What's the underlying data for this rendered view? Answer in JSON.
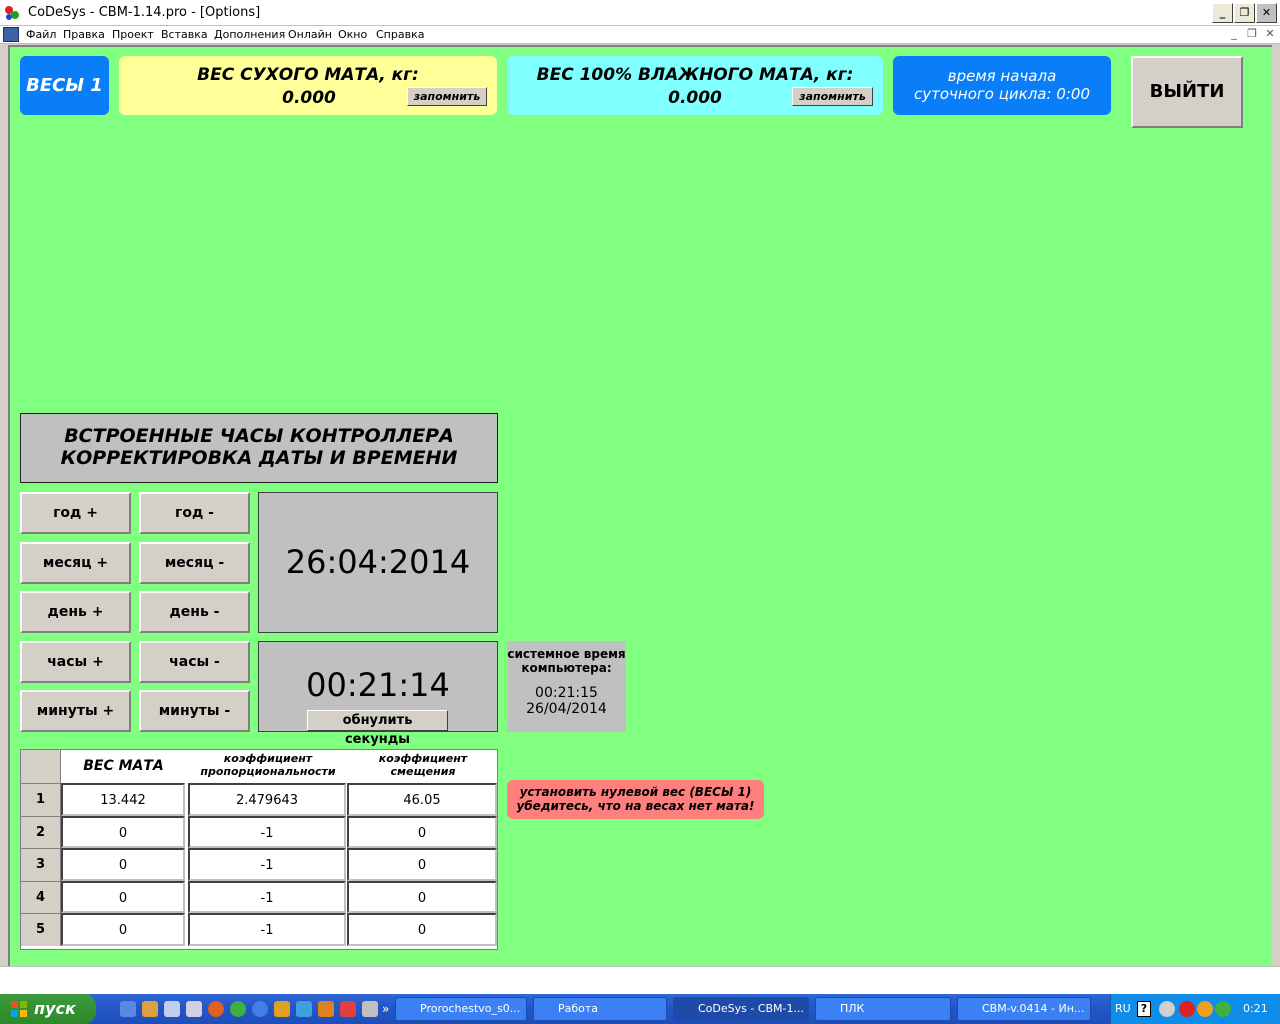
{
  "window": {
    "title": "CoDeSys - CBM-1.14.pro - [Options]",
    "min_label": "_",
    "max_label": "❐",
    "close_label": "✕"
  },
  "menu": {
    "items": [
      "Файл",
      "Правка",
      "Проект",
      "Вставка",
      "Дополнения",
      "Онлайн",
      "Окно",
      "Справка"
    ],
    "mdi": [
      "_",
      "❐",
      "✕"
    ]
  },
  "header": {
    "scale_label": "ВЕСЫ 1",
    "dry_label": "ВЕС СУХОГО МАТА, кг:",
    "dry_value": "0.000",
    "dry_btn": "запомнить",
    "wet_label": "ВЕС 100% ВЛАЖНОГО  МАТА, кг:",
    "wet_value": "0.000",
    "wet_btn": "запомнить",
    "cycle_line1": "время начала",
    "cycle_line2": "суточного цикла: 0:00",
    "exit_label": "ВЫЙТИ"
  },
  "clock": {
    "title1": "ВСТРОЕННЫЕ ЧАСЫ КОНТРОЛЛЕРА",
    "title2": "КОРРЕКТИРОВКА ДАТЫ И ВРЕМЕНИ",
    "buttons": [
      {
        "plus": "год +",
        "minus": "год -"
      },
      {
        "plus": "месяц +",
        "minus": "месяц -"
      },
      {
        "plus": "день +",
        "minus": "день -"
      },
      {
        "plus": "часы +",
        "minus": "часы -"
      },
      {
        "plus": "минуты +",
        "minus": "минуты -"
      }
    ],
    "date": "26:04:2014",
    "time": "00:21:14",
    "reset_btn": "обнулить секунды",
    "sys_label1": "системное время",
    "sys_label2": "компьютера:",
    "sys_time": "00:21:15",
    "sys_date": "26/04/2014"
  },
  "table": {
    "headers": [
      "ВЕС МАТА",
      "коэффициент пропорциональности",
      "коэффициент смещения"
    ],
    "header_lines": {
      "col1": "ВЕС МАТА",
      "col2a": "коэффициент",
      "col2b": "пропорциональности",
      "col3a": "коэффициент",
      "col3b": "смещения"
    },
    "rows": [
      {
        "n": "1",
        "w": "13.442",
        "k": "2.479643",
        "s": "46.05"
      },
      {
        "n": "2",
        "w": "0",
        "k": "-1",
        "s": "0"
      },
      {
        "n": "3",
        "w": "0",
        "k": "-1",
        "s": "0"
      },
      {
        "n": "4",
        "w": "0",
        "k": "-1",
        "s": "0"
      },
      {
        "n": "5",
        "w": "0",
        "k": "-1",
        "s": "0"
      }
    ]
  },
  "zero_btn": {
    "line1": "установить нулевой вес (ВЕСЫ 1)",
    "line2": "убедитесь, что на весах нет мата!"
  },
  "taskbar": {
    "start": "пуск",
    "tasks": [
      "Prorochestvo_s0...",
      "Работа",
      "CoDeSys - CBM-1...",
      "ПЛК",
      "CBM-v.0414 - Ин..."
    ],
    "lang": "RU",
    "clock": "0:21"
  },
  "colors": {
    "workspace": "#80ff80",
    "blue": "#0a7ef8",
    "yellow": "#ffff99",
    "cyan": "#80ffff",
    "red": "#ff7f7f",
    "panel": "#c0c0c0"
  }
}
